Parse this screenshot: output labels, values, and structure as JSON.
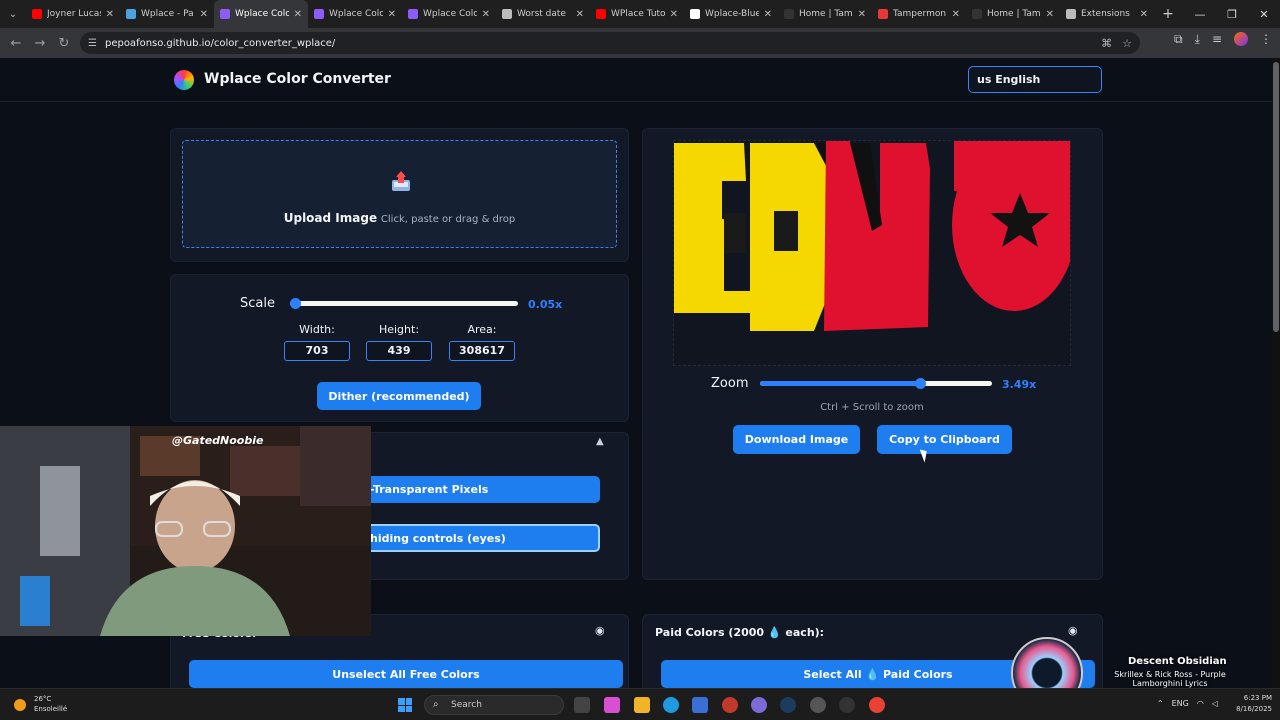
{
  "browser": {
    "tabs": [
      {
        "label": "Joyner Lucas",
        "color": "#ff0000"
      },
      {
        "label": "Wplace - Pa",
        "color": "#4aa3df"
      },
      {
        "label": "Wplace Colo",
        "color": "#8b5cf6"
      },
      {
        "label": "Wplace Colo",
        "color": "#8b5cf6"
      },
      {
        "label": "Wplace Colo",
        "color": "#8b5cf6"
      },
      {
        "label": "Worst date",
        "color": "#bbbbbb"
      },
      {
        "label": "WPlace Tuto",
        "color": "#ff0000"
      },
      {
        "label": "Wplace-Blue",
        "color": "#ffffff"
      },
      {
        "label": "Home | Tam",
        "color": "#333333"
      },
      {
        "label": "Tampermon",
        "color": "#e53935"
      },
      {
        "label": "Home | Tam",
        "color": "#333333"
      },
      {
        "label": "Extensions",
        "color": "#bbbbbb"
      }
    ],
    "active_tab": 2,
    "url": "pepoafonso.github.io/color_converter_wplace/"
  },
  "app": {
    "title": "Wplace Color Converter",
    "language": "us English"
  },
  "upload": {
    "title": "Upload Image",
    "hint": "Click, paste or drag & drop"
  },
  "scale": {
    "label": "Scale",
    "value": "0.05x",
    "level": 0.02
  },
  "dimensions": {
    "width_label": "Width:",
    "width": "703",
    "height_label": "Height:",
    "height": "439",
    "area_label": "Area:",
    "area": "308617"
  },
  "buttons": {
    "dither": "Dither (recommended)",
    "transparent": "-Transparent Pixels",
    "hiding_controls": "hiding controls (eyes)",
    "download": "Download Image",
    "copy": "Copy to Clipboard",
    "unselect_free": "Unselect All Free Colors",
    "select_paid": "Select All 💧 Paid Colors"
  },
  "zoom": {
    "label": "Zoom",
    "value": "3.49x",
    "level": 0.69,
    "hint": "Ctrl + Scroll to zoom"
  },
  "palettes": {
    "free_label": "Free Colors:",
    "paid_label": "Paid Colors (2000 💧 each):"
  },
  "webcam": {
    "handle": "@GatedNoobie"
  },
  "now_playing": {
    "title": "Descent Obsidian",
    "subtitle": "Skrillex & Rick Ross - Purple Lamborghini Lyrics"
  },
  "taskbar": {
    "temp": "26°C",
    "condition": "Ensoleillé",
    "search": "Search",
    "lang": "ENG",
    "time": "6:23 PM",
    "date": "8/16/2025"
  },
  "colors": {
    "accent": "#1e7ef0",
    "preview_yellow": "#f5d800",
    "preview_red": "#e0102f"
  }
}
